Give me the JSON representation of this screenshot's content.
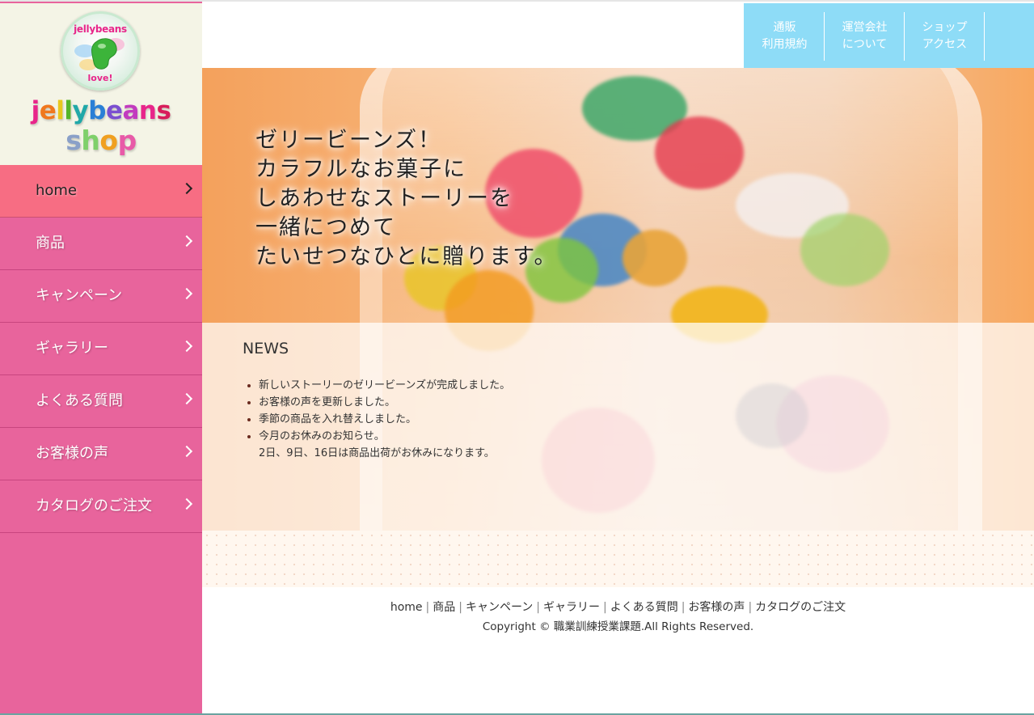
{
  "logo": {
    "badge_top": "jellybeans",
    "badge_bottom": "love!",
    "word1_letters": [
      {
        "ch": "j",
        "color": "#e8258a"
      },
      {
        "ch": "e",
        "color": "#f0781e"
      },
      {
        "ch": "l",
        "color": "#e8c81e"
      },
      {
        "ch": "l",
        "color": "#55b52a"
      },
      {
        "ch": "y",
        "color": "#20a8a8"
      },
      {
        "ch": "b",
        "color": "#2a7fd6"
      },
      {
        "ch": "e",
        "color": "#7b4fd0"
      },
      {
        "ch": "a",
        "color": "#c23bbf"
      },
      {
        "ch": "n",
        "color": "#e8258a"
      },
      {
        "ch": "s",
        "color": "#d81d5b"
      }
    ],
    "word2_letters": [
      {
        "ch": "s",
        "color": "#8aa0c8"
      },
      {
        "ch": "h",
        "color": "#7fd06a"
      },
      {
        "ch": "o",
        "color": "#f0a020"
      },
      {
        "ch": "p",
        "color": "#e85aa8"
      }
    ]
  },
  "sidebar": {
    "items": [
      {
        "label": "home",
        "active": true
      },
      {
        "label": "商品",
        "active": false
      },
      {
        "label": "キャンペーン",
        "active": false
      },
      {
        "label": "ギャラリー",
        "active": false
      },
      {
        "label": "よくある質問",
        "active": false
      },
      {
        "label": "お客様の声",
        "active": false
      },
      {
        "label": "カタログのご注文",
        "active": false
      }
    ]
  },
  "topmenu": {
    "items": [
      {
        "line1": "通販",
        "line2": "利用規約"
      },
      {
        "line1": "運営会社",
        "line2": "について"
      },
      {
        "line1": "ショップ",
        "line2": "アクセス"
      }
    ]
  },
  "hero": {
    "lines": [
      "ゼリービーンズ！",
      "カラフルなお菓子に",
      "しあわせなストーリーを",
      "一緒につめて",
      "たいせつなひとに贈ります。"
    ]
  },
  "news": {
    "title": "NEWS",
    "items": [
      {
        "text": "新しいストーリーのゼリービーンズが完成しました。",
        "sub": ""
      },
      {
        "text": "お客様の声を更新しました。",
        "sub": ""
      },
      {
        "text": "季節の商品を入れ替えしました。",
        "sub": ""
      },
      {
        "text": "今月のお休みのお知らせ。",
        "sub": "2日、9日、16日は商品出荷がお休みになります。"
      }
    ]
  },
  "footer": {
    "links": [
      "home",
      "商品",
      "キャンペーン",
      "ギャラリー",
      "よくある質問",
      "お客様の声",
      "カタログのご注文"
    ],
    "separator": "|",
    "copyright": "Copyright © 職業訓練授業課題.All Rights Reserved."
  },
  "colors": {
    "sidebar": "#e8649c",
    "active_nav": "#f76d83",
    "topmenu": "#8edcf7",
    "logo_bg": "#f4f4e6"
  }
}
